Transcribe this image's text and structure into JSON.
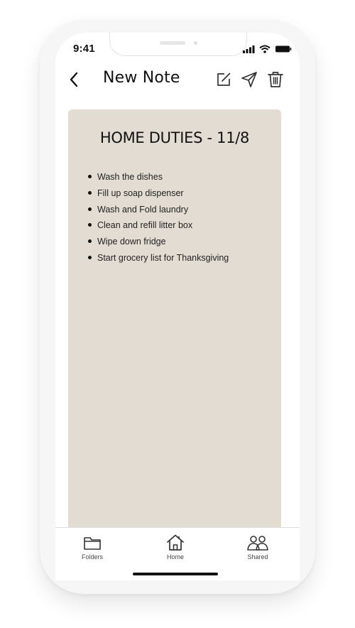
{
  "status_bar": {
    "time": "9:41"
  },
  "header": {
    "title": "New Note",
    "actions": [
      "edit-icon",
      "send-icon",
      "trash-icon"
    ]
  },
  "note": {
    "title": "HOME DUTIES - 11/8",
    "background_color": "#e3dcd3",
    "items": [
      "Wash the dishes",
      "Fill up soap dispenser",
      "Wash and Fold laundry",
      "Clean and refill litter box",
      "Wipe down fridge",
      "Start grocery list for Thanksgiving"
    ]
  },
  "tab_bar": {
    "tabs": [
      {
        "label": "Folders",
        "icon": "folder-icon"
      },
      {
        "label": "Home",
        "icon": "home-icon"
      },
      {
        "label": "Shared",
        "icon": "people-icon"
      }
    ]
  }
}
